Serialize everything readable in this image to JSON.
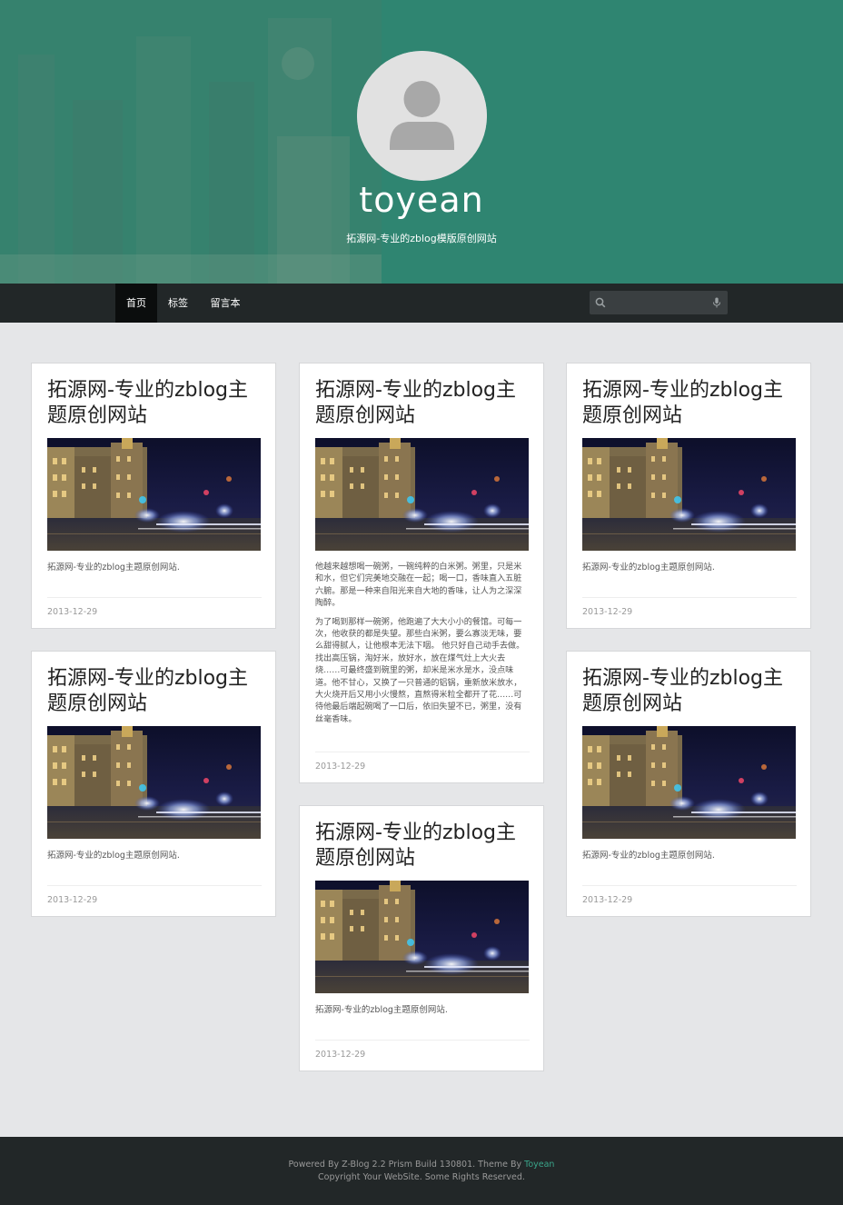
{
  "header": {
    "site_title": "toyean",
    "site_subtitle": "拓源网-专业的zblog模版原创网站"
  },
  "nav": {
    "items": [
      {
        "label": "首页",
        "active": true
      },
      {
        "label": "标签",
        "active": false
      },
      {
        "label": "留言本",
        "active": false
      }
    ],
    "search": {
      "placeholder": "",
      "value": "",
      "icons": [
        "search-icon",
        "microphone-icon"
      ]
    }
  },
  "posts": [
    {
      "title": "拓源网-专业的zblog主题原创网站",
      "excerpt": [
        "拓源网-专业的zblog主题原创网站."
      ],
      "date": "2013-12-29"
    },
    {
      "title": "拓源网-专业的zblog主题原创网站",
      "excerpt": [
        "他越来越想喝一碗粥，一碗纯粹的白米粥。粥里，只是米和水，但它们完美地交融在一起；喝一口，香味直入五脏六腑。那是一种来自阳光来自大地的香味，让人为之深深陶醉。",
        "为了喝到那样一碗粥，他跑遍了大大小小的餐馆。可每一次，他收获的都是失望。那些白米粥，要么寡淡无味，要么甜得腻人，让他根本无法下咽。 他只好自己动手去做。找出高压锅，淘好米，放好水，放在煤气灶上大火去烧……可最终盛到碗里的粥，却米是米水是水，没点味道。他不甘心，又换了一只普通的铝锅，重新放米放水，大火烧开后又用小火慢熬，直熬得米粒全都开了花……可待他最后端起碗喝了一口后，依旧失望不已，粥里，没有丝毫香味。"
      ],
      "date": "2013-12-29"
    },
    {
      "title": "拓源网-专业的zblog主题原创网站",
      "excerpt": [
        "拓源网-专业的zblog主题原创网站."
      ],
      "date": "2013-12-29"
    },
    {
      "title": "拓源网-专业的zblog主题原创网站",
      "excerpt": [
        "拓源网-专业的zblog主题原创网站."
      ],
      "date": "2013-12-29"
    },
    {
      "title": "拓源网-专业的zblog主题原创网站",
      "excerpt": [
        "拓源网-专业的zblog主题原创网站."
      ],
      "date": "2013-12-29"
    },
    {
      "title": "拓源网-专业的zblog主题原创网站",
      "excerpt": [
        "拓源网-专业的zblog主题原创网站."
      ],
      "date": "2013-12-29"
    }
  ],
  "footer": {
    "powered_prefix": "Powered By Z-Blog 2.2 Prism Build 130801. Theme By ",
    "theme_link": "Toyean",
    "copyright": "Copyright Your WebSite. Some Rights Reserved."
  },
  "colors": {
    "header_bg": "#2f8571",
    "nav_bg": "#222728",
    "nav_active": "#0b0d0d",
    "page_bg": "#e5e6e8",
    "link_accent": "#3aa58a"
  }
}
